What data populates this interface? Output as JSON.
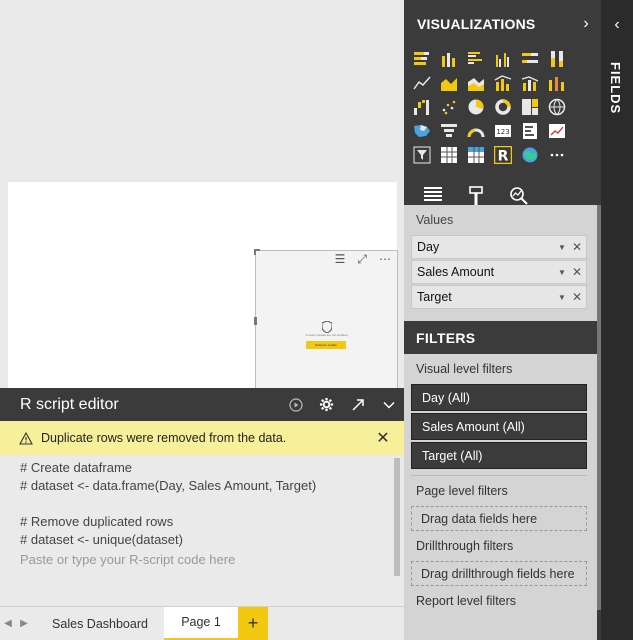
{
  "editor": {
    "title": "R script editor",
    "warning": "Duplicate rows were removed from the data.",
    "code_lines": [
      "# Create dataframe",
      "# dataset <- data.frame(Day, Sales Amount, Target)",
      "",
      "# Remove duplicated rows",
      "# dataset <- unique(dataset)"
    ],
    "placeholder": "Paste or type your R-script code here"
  },
  "visual": {
    "placeholder_text": "R script visuals are not enabled",
    "enable_button": "Select to enable"
  },
  "tabs": {
    "items": [
      "Sales Dashboard",
      "Page 1"
    ],
    "add": "+"
  },
  "visualizations": {
    "title": "VISUALIZATIONS",
    "icons": [
      "stacked-bar-icon",
      "stacked-column-icon",
      "clustered-bar-icon",
      "clustered-column-icon",
      "100-stacked-bar-icon",
      "100-stacked-column-icon",
      "line-chart-icon",
      "area-chart-icon",
      "stacked-area-icon",
      "line-clustered-column-icon",
      "line-stacked-column-icon",
      "ribbon-chart-icon",
      "waterfall-icon",
      "scatter-icon",
      "pie-icon",
      "donut-icon",
      "treemap-icon",
      "map-icon",
      "filled-map-icon",
      "funnel-icon",
      "gauge-icon",
      "card-icon",
      "multi-row-card-icon",
      "kpi-icon",
      "slicer-icon",
      "table-icon",
      "matrix-icon",
      "r-visual-icon",
      "arcgis-icon",
      "more-icon"
    ],
    "sub_tabs": [
      "fields-tab-icon",
      "format-tab-icon",
      "analytics-tab-icon"
    ]
  },
  "values": {
    "label": "Values",
    "fields": [
      "Day",
      "Sales Amount",
      "Target"
    ]
  },
  "filters": {
    "title": "FILTERS",
    "visual_level": "Visual level filters",
    "visual_filters": [
      "Day (All)",
      "Sales Amount (All)",
      "Target (All)"
    ],
    "page_level": "Page level filters",
    "page_drop": "Drag data fields here",
    "drillthrough": "Drillthrough filters",
    "drillthrough_drop": "Drag drillthrough fields here",
    "report_level": "Report level filters"
  },
  "fields_pane": {
    "label": "FIELDS"
  },
  "colors": {
    "accent": "#f2c811",
    "pane_dark": "#3b3b3b",
    "warning_bg": "#f7f09a"
  }
}
